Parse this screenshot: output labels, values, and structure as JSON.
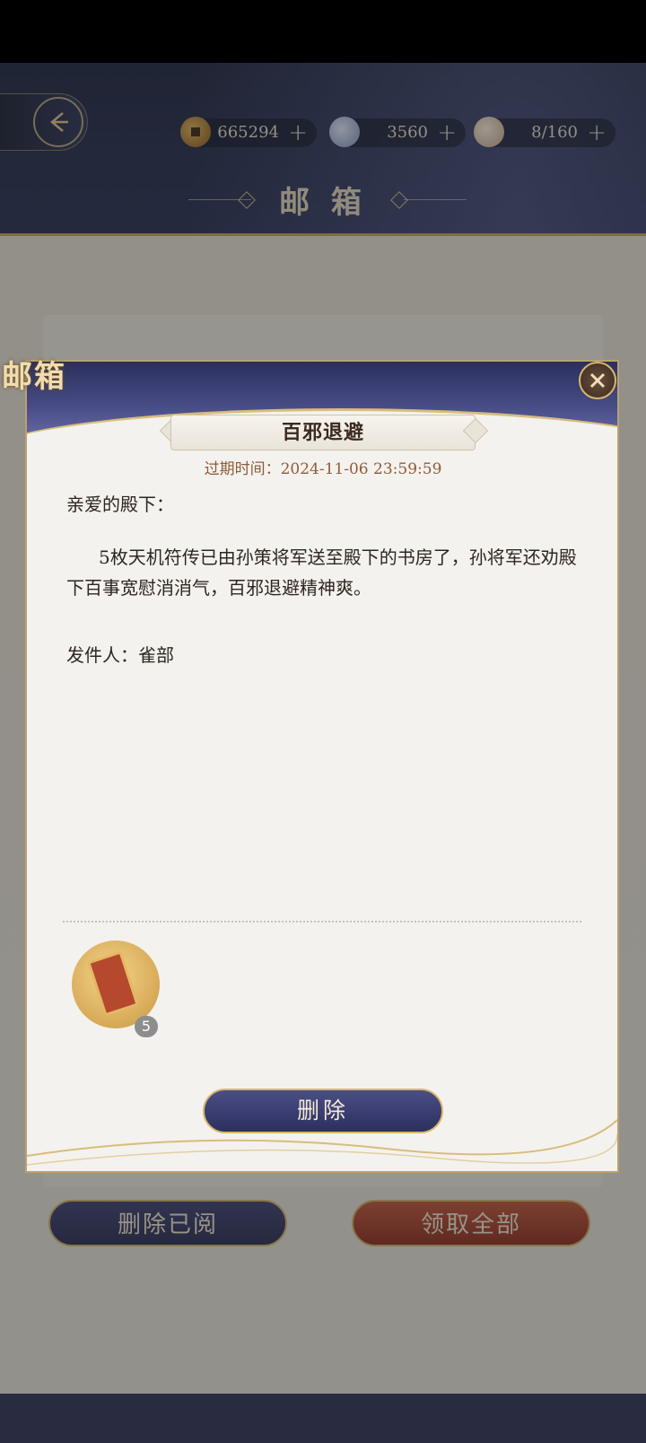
{
  "header": {
    "title": "邮 箱",
    "resources": [
      {
        "icon": "copper-coin-icon",
        "value": "665294",
        "plus": "+"
      },
      {
        "icon": "jade-orb-icon",
        "value": "3560",
        "plus": "+"
      },
      {
        "icon": "bowl-icon",
        "value": "8/160",
        "plus": "+"
      }
    ]
  },
  "footer": {
    "delete_read_label": "删除已阅",
    "claim_all_label": "领取全部"
  },
  "modal": {
    "tag": "邮箱",
    "mail_title": "百邪退避",
    "expire_text": "过期时间：2024-11-06 23:59:59",
    "greeting": "亲爱的殿下：",
    "paragraph": "5枚天机符传已由孙策将军送至殿下的书房了，孙将军还劝殿下百事宽慰消消气，百邪退避精神爽。",
    "sender": "发件人：雀部",
    "attachment": {
      "icon": "talisman-icon",
      "count": "5"
    },
    "delete_label": "删除"
  },
  "colors": {
    "accent_gold": "#d7b76a",
    "navy": "#2c2f5e",
    "red_button": "#c25539",
    "expire_text": "#8f5b3a"
  }
}
